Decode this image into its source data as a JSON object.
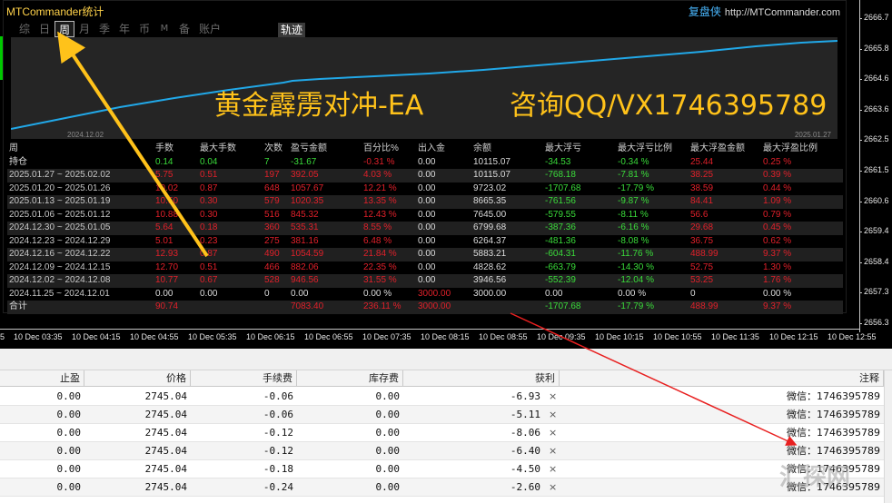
{
  "panel": {
    "title": "MTCommander统计",
    "brand": "复盘侠",
    "url": "http://MTCommander.com",
    "tabs": [
      "综",
      "日",
      "周",
      "月",
      "季",
      "年",
      "币",
      "M",
      "备",
      "账户"
    ],
    "active_tab": "周",
    "track_button": "轨迹",
    "date_start": "2024.12.02",
    "date_end": "2025.01.27",
    "overlay_left": "黄金霹雳对冲-EA",
    "overlay_right": "咨询QQ/VX1746395789"
  },
  "stats": {
    "headers": [
      "周",
      "手数",
      "最大手数",
      "次数",
      "盈亏金额",
      "百分比%",
      "出入金",
      "余额",
      "最大浮亏",
      "最大浮亏比例",
      "最大浮盈金额",
      "最大浮盈比例"
    ],
    "rows": [
      {
        "cells": [
          "持仓",
          "0.14",
          "0.04",
          "7",
          "-31.67",
          "-0.31 %",
          "0.00",
          "10115.07",
          "-34.53",
          "-0.34 %",
          "25.44",
          "0.25 %"
        ],
        "colors": [
          "w",
          "g",
          "g",
          "g",
          "g",
          "r",
          "w",
          "w",
          "g",
          "g",
          "r",
          "r"
        ]
      },
      {
        "cells": [
          "2025.01.27 ~ 2025.02.02",
          "5.75",
          "0.51",
          "197",
          "392.05",
          "4.03 %",
          "0.00",
          "10115.07",
          "-768.18",
          "-7.81 %",
          "38.25",
          "0.39 %"
        ],
        "colors": [
          "p",
          "r",
          "r",
          "r",
          "r",
          "r",
          "w",
          "w",
          "g",
          "g",
          "r",
          "r"
        ]
      },
      {
        "cells": [
          "2025.01.20 ~ 2025.01.26",
          "10.02",
          "0.87",
          "648",
          "1057.67",
          "12.21 %",
          "0.00",
          "9723.02",
          "-1707.68",
          "-17.79 %",
          "38.59",
          "0.44 %"
        ],
        "colors": [
          "p",
          "r",
          "r",
          "r",
          "r",
          "r",
          "w",
          "w",
          "g",
          "g",
          "r",
          "r"
        ]
      },
      {
        "cells": [
          "2025.01.13 ~ 2025.01.19",
          "10.50",
          "0.30",
          "579",
          "1020.35",
          "13.35 %",
          "0.00",
          "8665.35",
          "-761.56",
          "-9.87 %",
          "84.41",
          "1.09 %"
        ],
        "colors": [
          "p",
          "r",
          "r",
          "r",
          "r",
          "r",
          "w",
          "w",
          "g",
          "g",
          "r",
          "r"
        ]
      },
      {
        "cells": [
          "2025.01.06 ~ 2025.01.12",
          "10.88",
          "0.30",
          "516",
          "845.32",
          "12.43 %",
          "0.00",
          "7645.00",
          "-579.55",
          "-8.11 %",
          "56.6",
          "0.79 %"
        ],
        "colors": [
          "p",
          "r",
          "r",
          "r",
          "r",
          "r",
          "w",
          "w",
          "g",
          "g",
          "r",
          "r"
        ]
      },
      {
        "cells": [
          "2024.12.30 ~ 2025.01.05",
          "5.64",
          "0.18",
          "360",
          "535.31",
          "8.55 %",
          "0.00",
          "6799.68",
          "-387.36",
          "-6.16 %",
          "29.68",
          "0.45 %"
        ],
        "colors": [
          "p",
          "r",
          "r",
          "r",
          "r",
          "r",
          "w",
          "w",
          "g",
          "g",
          "r",
          "r"
        ]
      },
      {
        "cells": [
          "2024.12.23 ~ 2024.12.29",
          "5.01",
          "0.23",
          "275",
          "381.16",
          "6.48 %",
          "0.00",
          "6264.37",
          "-481.36",
          "-8.08 %",
          "36.75",
          "0.62 %"
        ],
        "colors": [
          "p",
          "r",
          "r",
          "r",
          "r",
          "r",
          "w",
          "w",
          "g",
          "g",
          "r",
          "r"
        ]
      },
      {
        "cells": [
          "2024.12.16 ~ 2024.12.22",
          "12.93",
          "0.87",
          "490",
          "1054.59",
          "21.84 %",
          "0.00",
          "5883.21",
          "-604.31",
          "-11.76 %",
          "488.99",
          "9.37 %"
        ],
        "colors": [
          "p",
          "r",
          "r",
          "r",
          "r",
          "r",
          "w",
          "w",
          "g",
          "g",
          "r",
          "r"
        ]
      },
      {
        "cells": [
          "2024.12.09 ~ 2024.12.15",
          "12.70",
          "0.51",
          "466",
          "882.06",
          "22.35 %",
          "0.00",
          "4828.62",
          "-663.79",
          "-14.30 %",
          "52.75",
          "1.30 %"
        ],
        "colors": [
          "p",
          "r",
          "r",
          "r",
          "r",
          "r",
          "w",
          "w",
          "g",
          "g",
          "r",
          "r"
        ]
      },
      {
        "cells": [
          "2024.12.02 ~ 2024.12.08",
          "10.77",
          "0.67",
          "528",
          "946.56",
          "31.55 %",
          "0.00",
          "3946.56",
          "-552.39",
          "-12.04 %",
          "53.25",
          "1.76 %"
        ],
        "colors": [
          "p",
          "r",
          "r",
          "r",
          "r",
          "r",
          "w",
          "w",
          "g",
          "g",
          "r",
          "r"
        ]
      },
      {
        "cells": [
          "2024.11.25 ~ 2024.12.01",
          "0.00",
          "0.00",
          "0",
          "0.00",
          "0.00 %",
          "3000.00",
          "3000.00",
          "0.00",
          "0.00 %",
          "0",
          "0.00 %"
        ],
        "colors": [
          "p",
          "w",
          "w",
          "w",
          "w",
          "w",
          "r",
          "w",
          "w",
          "w",
          "w",
          "w"
        ]
      }
    ],
    "total": {
      "cells": [
        "合计",
        "90.74",
        "",
        "",
        "7083.40",
        "236.11 %",
        "3000.00",
        "",
        "-1707.68",
        "-17.79 %",
        "488.99",
        "9.37 %"
      ],
      "colors": [
        "w",
        "r",
        "r",
        "r",
        "r",
        "r",
        "r",
        "w",
        "g",
        "g",
        "r",
        "r"
      ]
    }
  },
  "price_axis": [
    "2666.7",
    "2665.8",
    "2664.6",
    "2663.6",
    "2662.5",
    "2661.5",
    "2660.6",
    "2659.4",
    "2658.4",
    "2657.3",
    "2656.3"
  ],
  "time_axis": [
    "5",
    "10 Dec 03:35",
    "10 Dec 04:15",
    "10 Dec 04:55",
    "10 Dec 05:35",
    "10 Dec 06:15",
    "10 Dec 06:55",
    "10 Dec 07:35",
    "10 Dec 08:15",
    "10 Dec 08:55",
    "10 Dec 09:35",
    "10 Dec 10:15",
    "10 Dec 10:55",
    "10 Dec 11:35",
    "10 Dec 12:15",
    "10 Dec 12:55"
  ],
  "terminal": {
    "headers": [
      "止盈",
      "价格",
      "手续费",
      "库存费",
      "获利",
      "注释"
    ],
    "rows": [
      [
        "0.00",
        "2745.04",
        "-0.06",
        "0.00",
        "-6.93",
        "微信：1746395789"
      ],
      [
        "0.00",
        "2745.04",
        "-0.06",
        "0.00",
        "-5.11",
        "微信：1746395789"
      ],
      [
        "0.00",
        "2745.04",
        "-0.12",
        "0.00",
        "-8.06",
        "微信：1746395789"
      ],
      [
        "0.00",
        "2745.04",
        "-0.12",
        "0.00",
        "-6.40",
        "微信：1746395789"
      ],
      [
        "0.00",
        "2745.04",
        "-0.18",
        "0.00",
        "-4.50",
        "微信：1746395789"
      ],
      [
        "0.00",
        "2745.04",
        "-0.24",
        "0.00",
        "-2.60",
        "微信：1746395789"
      ]
    ],
    "close_icon": "×"
  },
  "watermark": "汇探网",
  "colors": {
    "profit_line": "#21a8e8",
    "gold_text": "#ffc21a",
    "red_arrow": "#e82020",
    "yellow_arrow": "#ffc21a"
  }
}
